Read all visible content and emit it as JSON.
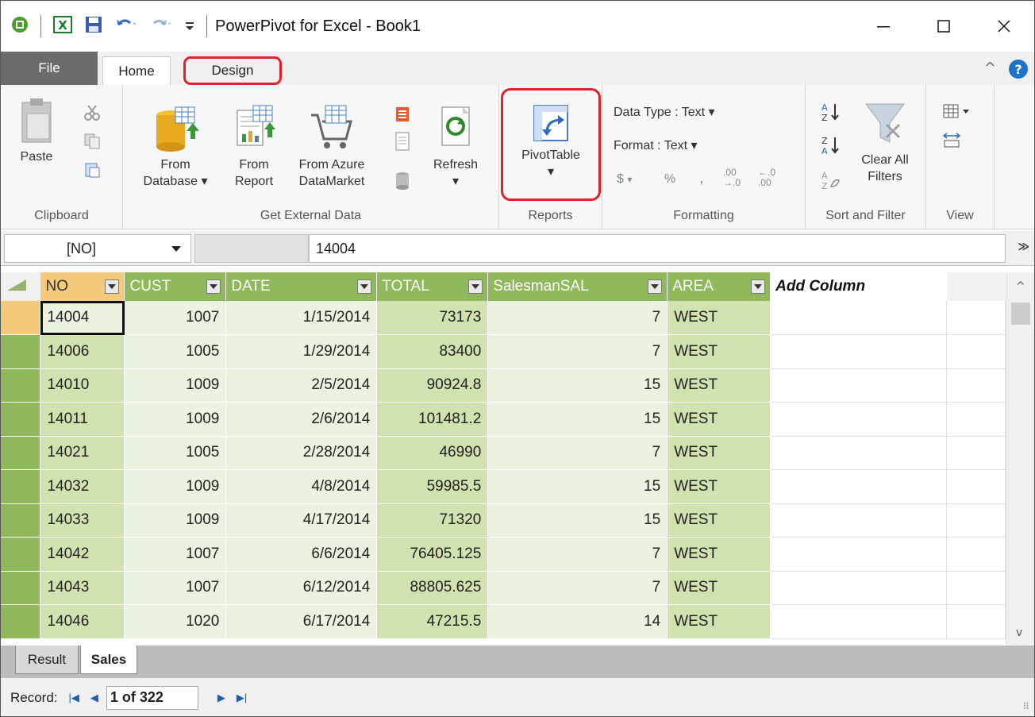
{
  "window": {
    "title": "PowerPivot for Excel - Book1"
  },
  "ribbon_tabs": [
    {
      "label": "File"
    },
    {
      "label": "Home"
    },
    {
      "label": "Design"
    }
  ],
  "ribbon": {
    "clipboard": {
      "paste": "Paste",
      "group": "Clipboard"
    },
    "external": {
      "from_database_1": "From",
      "from_database_2": "Database ▾",
      "from_report_1": "From",
      "from_report_2": "Report",
      "from_azure_1": "From Azure",
      "from_azure_2": "DataMarket",
      "refresh": "Refresh",
      "group": "Get External Data"
    },
    "reports": {
      "pivot": "PivotTable",
      "group": "Reports"
    },
    "formatting": {
      "data_type": "Data Type : Text ▾",
      "format": "Format : Text ▾",
      "currency": "$",
      "percent": "%",
      "comma": ",",
      "inc_dec_1": ".00",
      "inc_dec_2": "→.0",
      "dec_dec_1": "←.0",
      "dec_dec_2": ".00",
      "group": "Formatting"
    },
    "sort_filter": {
      "clear_1": "Clear All",
      "clear_2": "Filters",
      "group": "Sort and Filter"
    },
    "view": {
      "group": "View"
    }
  },
  "formula_bar": {
    "name_box": "[NO]",
    "value": "14004"
  },
  "grid": {
    "columns": [
      "NO",
      "CUST",
      "DATE",
      "TOTAL",
      "SalesmanSAL",
      "AREA",
      "Add Column"
    ],
    "rows": [
      [
        "14004",
        "1007",
        "1/15/2014",
        "73173",
        "7",
        "WEST"
      ],
      [
        "14006",
        "1005",
        "1/29/2014",
        "83400",
        "7",
        "WEST"
      ],
      [
        "14010",
        "1009",
        "2/5/2014",
        "90924.8",
        "15",
        "WEST"
      ],
      [
        "14011",
        "1009",
        "2/6/2014",
        "101481.2",
        "15",
        "WEST"
      ],
      [
        "14021",
        "1005",
        "2/28/2014",
        "46990",
        "7",
        "WEST"
      ],
      [
        "14032",
        "1009",
        "4/8/2014",
        "59985.5",
        "15",
        "WEST"
      ],
      [
        "14033",
        "1009",
        "4/17/2014",
        "71320",
        "15",
        "WEST"
      ],
      [
        "14042",
        "1007",
        "6/6/2014",
        "76405.125",
        "7",
        "WEST"
      ],
      [
        "14043",
        "1007",
        "6/12/2014",
        "88805.625",
        "7",
        "WEST"
      ],
      [
        "14046",
        "1020",
        "6/17/2014",
        "47215.5",
        "14",
        "WEST"
      ]
    ]
  },
  "sheet_tabs": [
    {
      "label": "Result"
    },
    {
      "label": "Sales"
    }
  ],
  "status": {
    "record_label": "Record:",
    "record_value": "1 of 322"
  },
  "colors": {
    "header_green": "#8fb95a",
    "highlight_red": "#e0202a",
    "help_blue": "#1e73c8"
  }
}
